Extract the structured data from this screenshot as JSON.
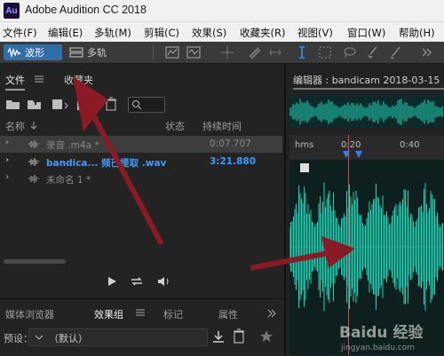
{
  "titlebar": {
    "logo": "Au",
    "title": "Adobe Audition CC 2018"
  },
  "menu": [
    "文件(F)",
    "编辑(E)",
    "多轨(M)",
    "剪辑(C)",
    "效果(S)",
    "收藏夹(R)",
    "视图(V)",
    "窗口(W)",
    "帮助(H)"
  ],
  "toolbar": {
    "waveform_label": "波形",
    "multitrack_label": "多轨"
  },
  "files_panel": {
    "tabs": [
      "文件",
      "收藏夹"
    ],
    "columns": {
      "name": "名称",
      "status": "状态",
      "duration": "持续时间"
    },
    "rows": [
      {
        "name": "录音 .m4a *",
        "duration": "0:07.707"
      },
      {
        "name": "bandica... 频已提取 .wav",
        "duration": "3:21.880"
      },
      {
        "name": "未命名 1 *",
        "duration": ""
      }
    ]
  },
  "bottom_panel": {
    "tabs": [
      "媒体浏览器",
      "效果组",
      "标记",
      "属性"
    ],
    "preset_label": "预设：",
    "preset_value": "（默认）"
  },
  "editor": {
    "title": "编辑器 : bandicam 2018-03-15 11-",
    "timeline": {
      "unit": "hms",
      "ticks": [
        "0:20",
        "0:40"
      ]
    }
  },
  "watermark": {
    "text": "Baidu 经验",
    "sub": "jingyan.baidu.com"
  },
  "colors": {
    "accent": "#2f6ea8",
    "waveform": "#1fd6b8",
    "arrow": "#8b1a24",
    "active_file": "#3b9bff"
  },
  "icons": [
    "close-icon",
    "folder-open-icon",
    "import-icon",
    "insert-icon",
    "trash-icon",
    "search-icon",
    "play-icon",
    "loop-icon",
    "volume-icon",
    "star-icon"
  ]
}
